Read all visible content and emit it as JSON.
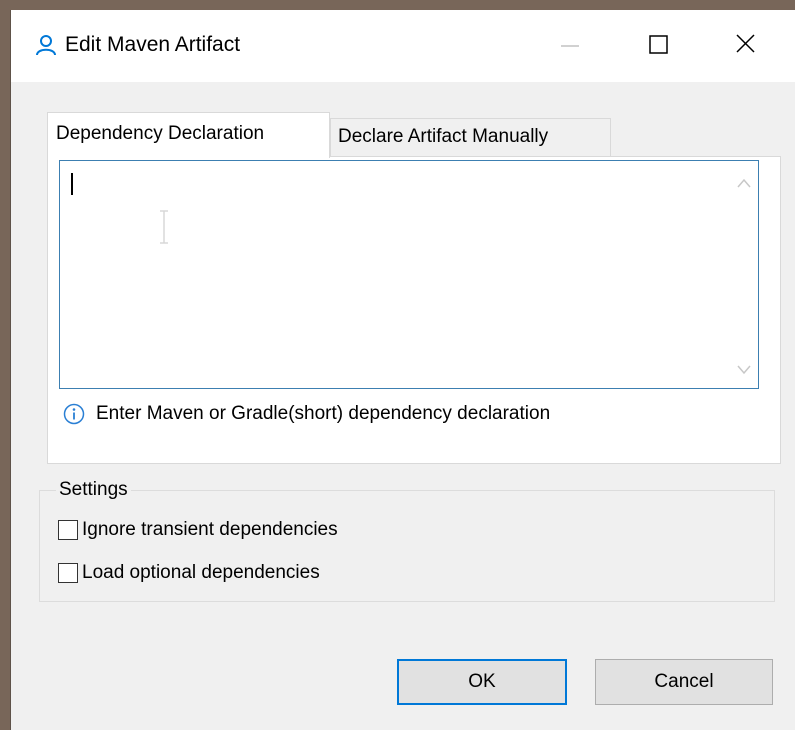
{
  "window": {
    "title": "Edit Maven Artifact",
    "icon": "user-icon",
    "accent_color": "#0078d7"
  },
  "tabs": [
    {
      "label": "Dependency Declaration",
      "selected": true
    },
    {
      "label": "Declare Artifact Manually",
      "selected": false
    }
  ],
  "declaration": {
    "value": "",
    "hint": "Enter Maven or Gradle(short) dependency declaration",
    "hint_icon": "info-icon"
  },
  "settings": {
    "title": "Settings",
    "options": [
      {
        "label": "Ignore transient dependencies",
        "checked": false
      },
      {
        "label": "Load optional dependencies",
        "checked": false
      }
    ]
  },
  "buttons": {
    "ok": "OK",
    "cancel": "Cancel"
  }
}
